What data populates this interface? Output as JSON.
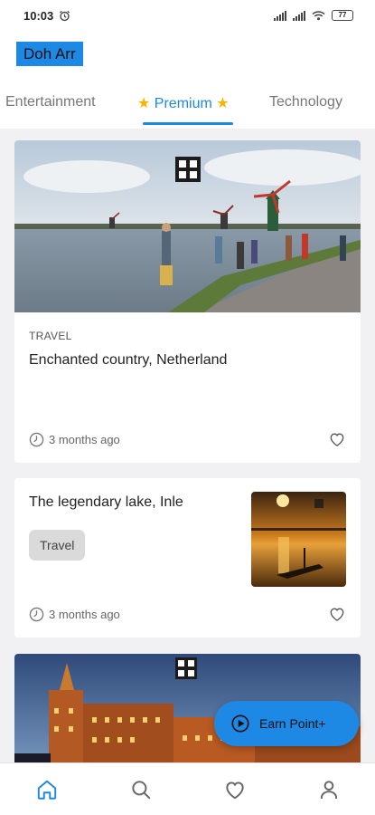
{
  "status_bar": {
    "time": "10:03",
    "battery": "77"
  },
  "app": {
    "brand": "Doh Arr"
  },
  "tabs": [
    {
      "label": "Entertainment",
      "active": false
    },
    {
      "label": "Premium",
      "active": true
    },
    {
      "label": "Technology",
      "active": false
    }
  ],
  "cards": [
    {
      "category": "TRAVEL",
      "title": "Enchanted country, Netherland",
      "time": "3 months ago"
    },
    {
      "title": "The legendary lake, Inle",
      "chip": "Travel",
      "time": "3 months ago"
    },
    {
      "title": ""
    }
  ],
  "fab": {
    "label": "Earn Point+"
  },
  "colors": {
    "accent": "#1e88e5",
    "star": "#f5b400"
  },
  "icons": [
    "alarm-icon",
    "signal-icon",
    "wifi-icon",
    "battery-icon",
    "watermark-logo-icon",
    "clock-icon",
    "heart-icon",
    "play-circle-icon",
    "home-icon",
    "search-icon",
    "favorite-icon",
    "profile-icon"
  ]
}
